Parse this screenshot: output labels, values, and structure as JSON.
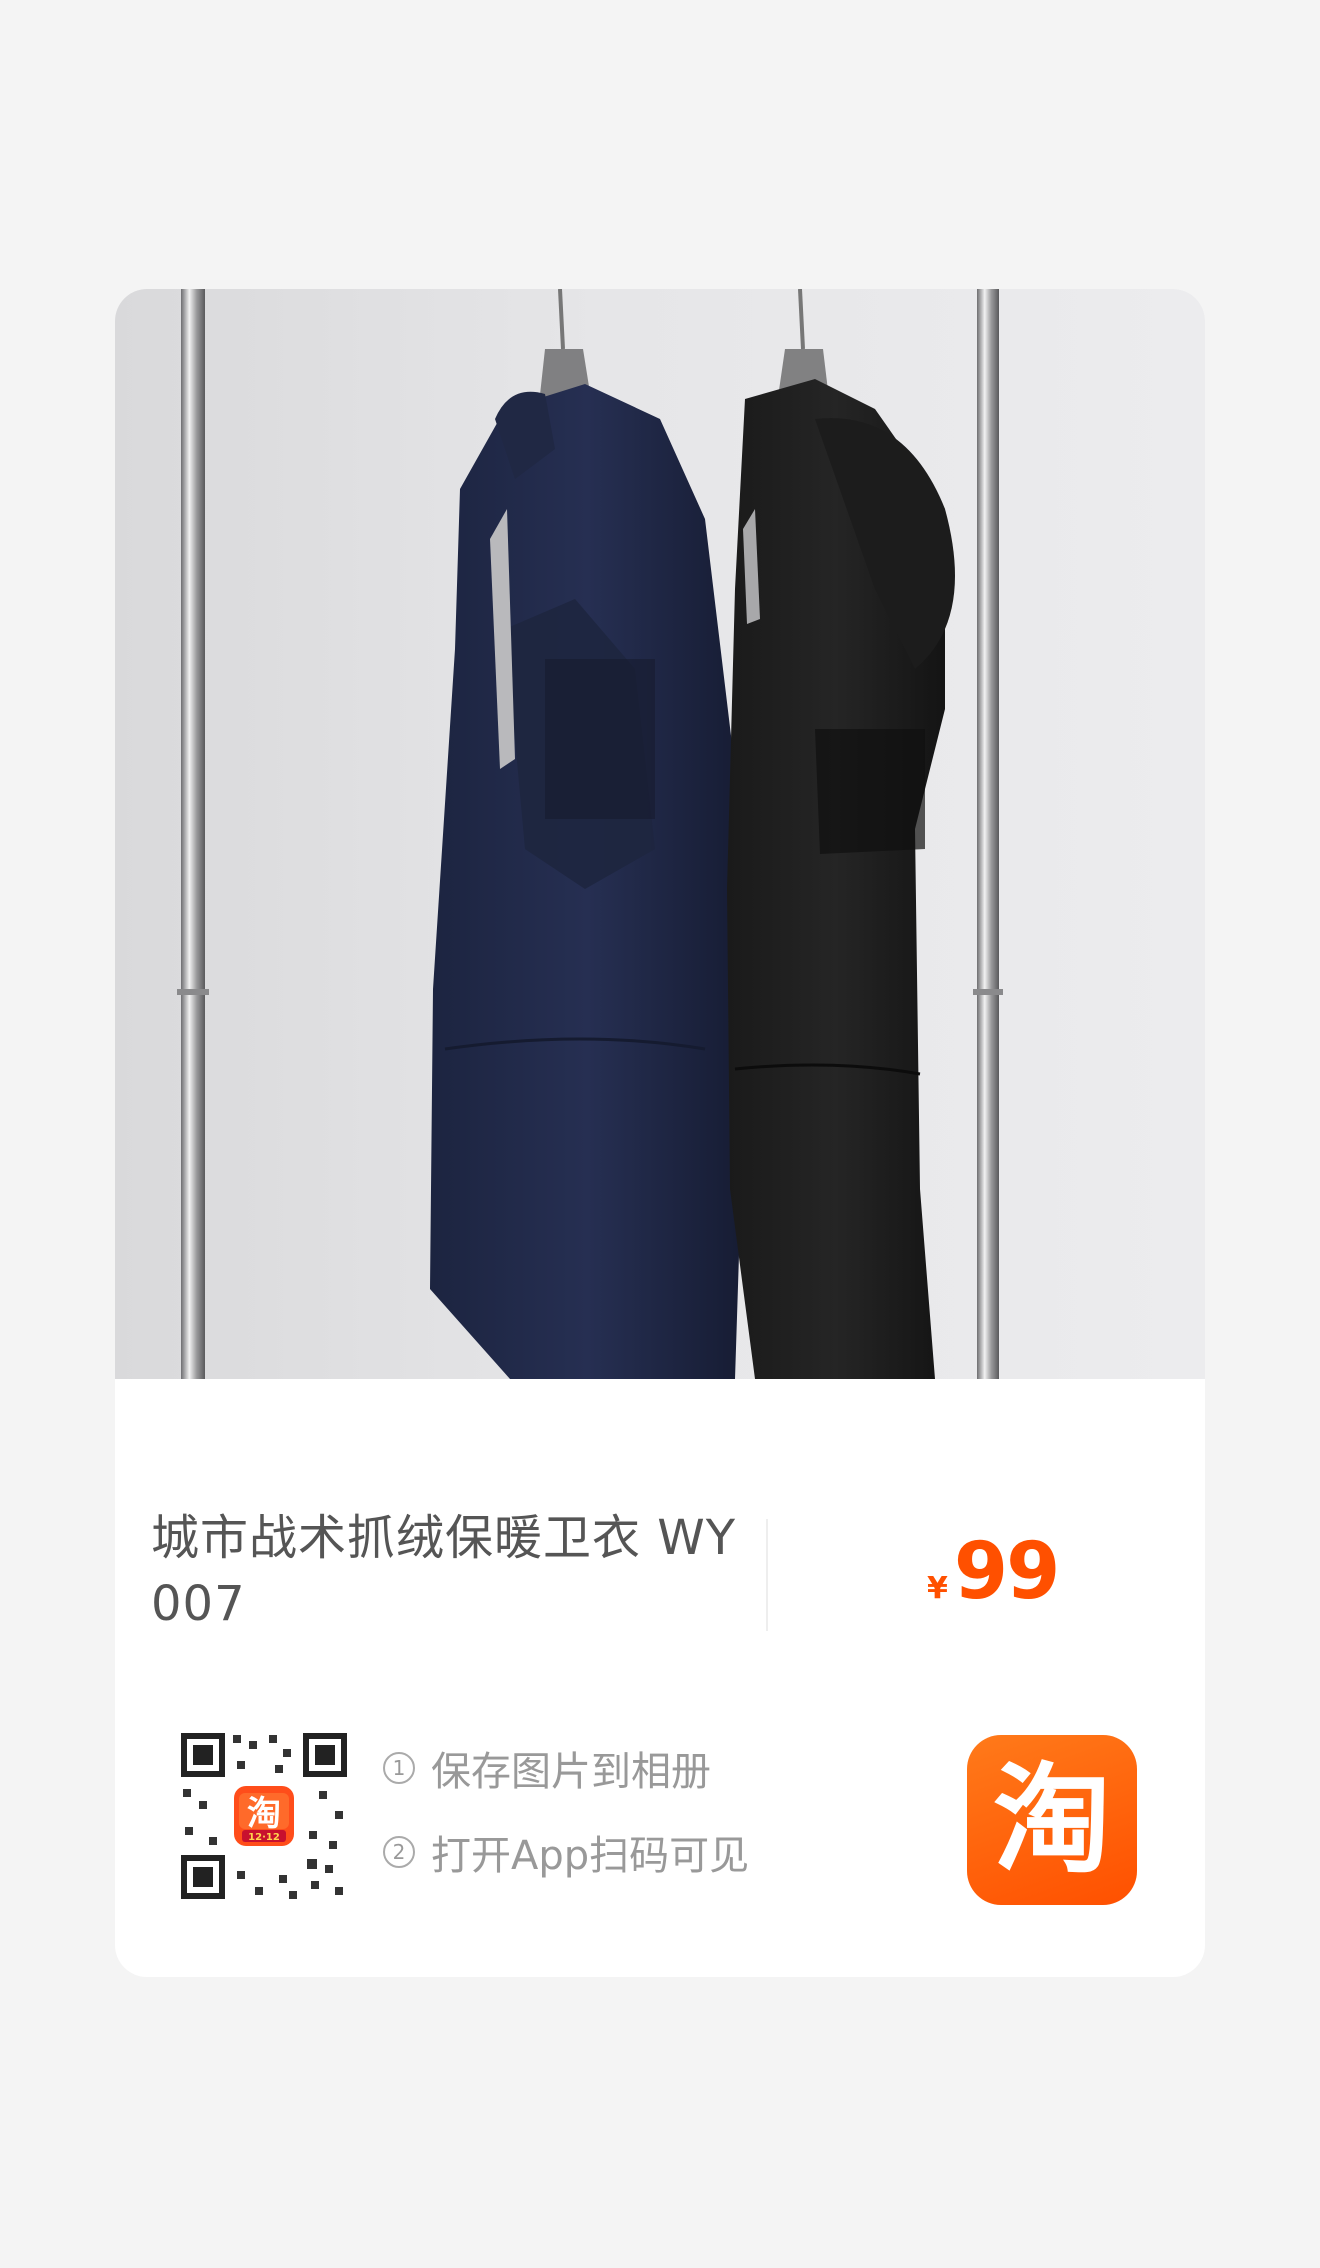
{
  "product": {
    "title": "城市战术抓绒保暖卫衣 WY007",
    "price_currency": "¥",
    "price_value": "99",
    "image": "photo of a navy and a black hooded fleece jacket hanging on a chrome clothes rack"
  },
  "qr_section": {
    "step1_index": "1",
    "step1_text": "保存图片到相册",
    "step2_index": "2",
    "step2_text": "打开App扫码可见",
    "qr_center_badge": "12·12"
  },
  "app_icon": {
    "glyph": "淘",
    "name": "taobao-app-icon"
  },
  "colors": {
    "accent": "#ff5000",
    "background": "#f4f4f4",
    "card": "#ffffff",
    "title_text": "#555555",
    "hint_text": "#999999"
  }
}
